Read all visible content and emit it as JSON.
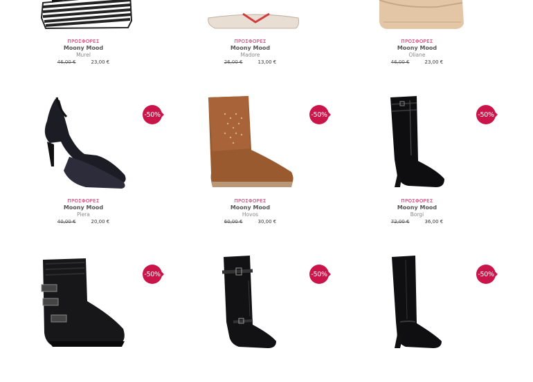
{
  "products": [
    {
      "promo": "ΠΡΟΣΦΟΡΕΣ",
      "brand": "Moony Mood",
      "model": "Murel",
      "old_price": "46,00 €",
      "new_price": "23,00 €",
      "discount": "",
      "shoe": "wedge-striped"
    },
    {
      "promo": "ΠΡΟΣΦΟΡΕΣ",
      "brand": "Moony Mood",
      "model": "Madore",
      "old_price": "26,00 €",
      "new_price": "13,00 €",
      "discount": "",
      "shoe": "sandal-flat"
    },
    {
      "promo": "ΠΡΟΣΦΟΡΕΣ",
      "brand": "Moony Mood",
      "model": "Oliane",
      "old_price": "46,00 €",
      "new_price": "23,00 €",
      "discount": "",
      "shoe": "wedge-beige"
    },
    {
      "promo": "ΠΡΟΣΦΟΡΕΣ",
      "brand": "Moony Mood",
      "model": "Piera",
      "old_price": "40,00 €",
      "new_price": "20,00 €",
      "discount": "-50%",
      "shoe": "slingback"
    },
    {
      "promo": "ΠΡΟΣΦΟΡΕΣ",
      "brand": "Moony Mood",
      "model": "Hovos",
      "old_price": "60,00 €",
      "new_price": "30,00 €",
      "discount": "-50%",
      "shoe": "ankle-boot-brown"
    },
    {
      "promo": "ΠΡΟΣΦΟΡΕΣ",
      "brand": "Moony Mood",
      "model": "Borgi",
      "old_price": "72,00 €",
      "new_price": "36,00 €",
      "discount": "-50%",
      "shoe": "tall-boot-patent"
    },
    {
      "promo": "",
      "brand": "",
      "model": "",
      "old_price": "",
      "new_price": "",
      "discount": "-50%",
      "shoe": "biker-boot"
    },
    {
      "promo": "",
      "brand": "",
      "model": "",
      "old_price": "",
      "new_price": "",
      "discount": "-50%",
      "shoe": "riding-boot"
    },
    {
      "promo": "",
      "brand": "",
      "model": "",
      "old_price": "",
      "new_price": "",
      "discount": "-50%",
      "shoe": "tall-boot-black"
    }
  ],
  "colors": {
    "accent": "#c9154a",
    "promo_text": "#d0245c"
  }
}
